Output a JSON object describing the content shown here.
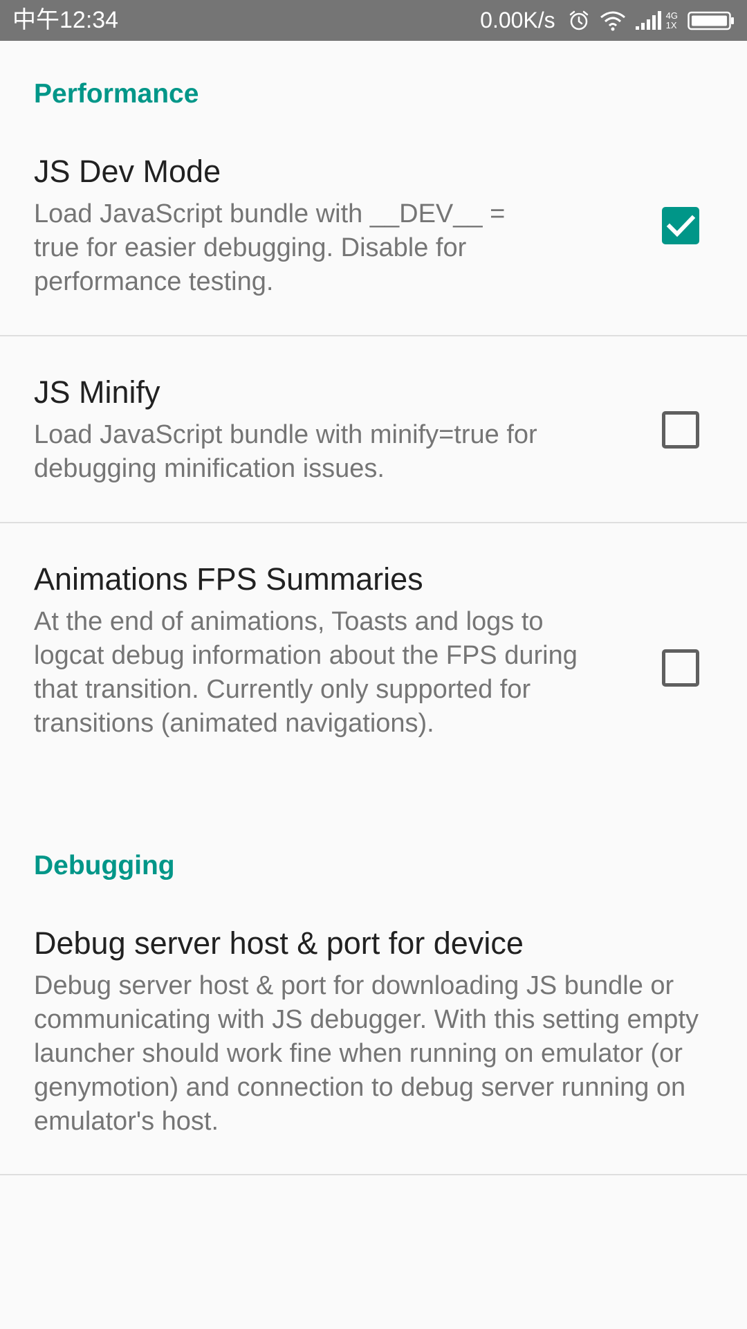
{
  "status_bar": {
    "time": "中午12:34",
    "speed": "0.00K/s",
    "network_top": "4G",
    "network_bottom": "1X",
    "icons": [
      "alarm-icon",
      "wifi-icon",
      "signal-icon",
      "battery-icon"
    ]
  },
  "colors": {
    "accent": "#009688",
    "status_bar_bg": "#757575",
    "title_text": "#212121",
    "summary_text": "#757575"
  },
  "sections": [
    {
      "category": "Performance",
      "preferences": [
        {
          "title": "JS Dev Mode",
          "summary": "Load JavaScript bundle with __DEV__ = true for easier debugging.  Disable for performance testing.",
          "checked": true
        },
        {
          "title": "JS Minify",
          "summary": "Load JavaScript bundle with minify=true for debugging minification issues.",
          "checked": false
        },
        {
          "title": "Animations FPS Summaries",
          "summary": "At the end of animations, Toasts and logs to logcat debug information about the FPS during that transition. Currently only supported for transitions (animated navigations).",
          "checked": false
        }
      ]
    },
    {
      "category": "Debugging",
      "preferences": [
        {
          "title": "Debug server host & port for device",
          "summary": "Debug server host & port for downloading JS bundle or communicating with JS debugger. With this setting empty launcher should work fine when running on emulator (or genymotion) and connection to debug server running on emulator's host."
        }
      ]
    }
  ]
}
